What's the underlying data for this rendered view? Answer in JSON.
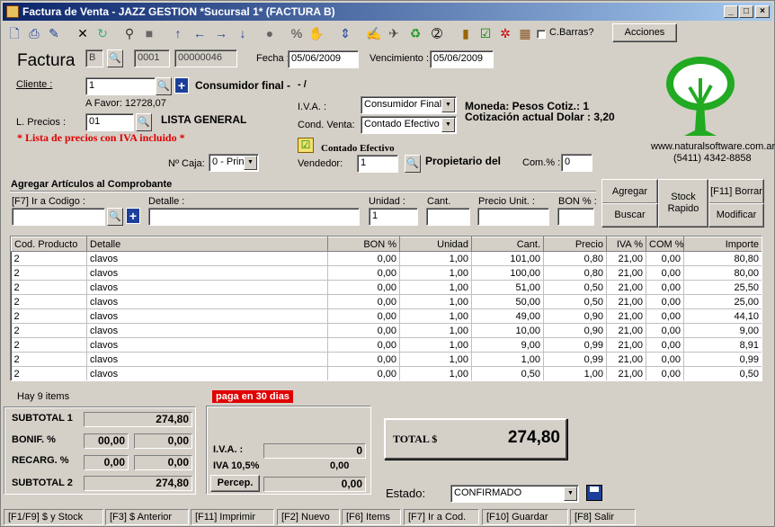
{
  "window": {
    "title": "Factura de Venta - JAZZ GESTION *Sucursal 1* (FACTURA B)"
  },
  "toolbar": {
    "barcode_label": "C.Barras?",
    "actions_label": "Acciones"
  },
  "header": {
    "factura_label": "Factura",
    "letter": "B",
    "punto_venta": "0001",
    "numero": "00000046",
    "fecha_label": "Fecha :",
    "fecha": "05/06/2009",
    "vencimiento_label": "Vencimiento :",
    "vencimiento": "05/06/2009",
    "cliente_label": "Cliente :",
    "cliente_code": "1",
    "cliente_name": "Consumidor final -",
    "cliente_extra": "- /",
    "a_favor": "A Favor: 12728,07",
    "lprecios_label": "L. Precios :",
    "lprecios_code": "01",
    "lprecios_name": "LISTA GENERAL",
    "iva_note": "* Lista de precios con IVA incluido *",
    "iva_label": "I.V.A. :",
    "iva_value": "Consumidor Final",
    "condventa_label": "Cond. Venta:",
    "condventa_value": "Contado Efectivo",
    "moneda": "Moneda: Pesos Cotiz.: 1",
    "cotizacion": "Cotización actual Dolar : 3,20",
    "contado_label": "Contado Efectivo",
    "caja_label": "Nº Caja:",
    "caja_value": "0 - Prin",
    "vendedor_label": "Vendedor:",
    "vendedor_code": "1",
    "vendedor_name": "Propietario del",
    "com_label": "Com.% :",
    "com_value": "0"
  },
  "company": {
    "web": "www.naturalsoftware.com.ar",
    "phone": "(5411) 4342-8858"
  },
  "add_items": {
    "section_title": "Agregar Artículos al Comprobante",
    "code_label": "[F7] Ir a Codigo :",
    "detail_label": "Detalle :",
    "unit_label": "Unidad :",
    "unit_value": "1",
    "qty_label": "Cant.",
    "price_label": "Precio Unit. :",
    "bon_label": "BON % :",
    "agregar": "Agregar",
    "buscar": "Buscar",
    "stock": "Stock Rapido",
    "borrar": "[F11] Borrar",
    "modificar": "Modificar"
  },
  "grid": {
    "columns": [
      "Cod. Producto",
      "Detalle",
      "BON %",
      "Unidad",
      "Cant.",
      "Precio",
      "IVA %",
      "COM %",
      "Importe"
    ],
    "rows": [
      [
        "2",
        "clavos",
        "0,00",
        "1,00",
        "101,00",
        "0,80",
        "21,00",
        "0,00",
        "80,80"
      ],
      [
        "2",
        "clavos",
        "0,00",
        "1,00",
        "100,00",
        "0,80",
        "21,00",
        "0,00",
        "80,00"
      ],
      [
        "2",
        "clavos",
        "0,00",
        "1,00",
        "51,00",
        "0,50",
        "21,00",
        "0,00",
        "25,50"
      ],
      [
        "2",
        "clavos",
        "0,00",
        "1,00",
        "50,00",
        "0,50",
        "21,00",
        "0,00",
        "25,00"
      ],
      [
        "2",
        "clavos",
        "0,00",
        "1,00",
        "49,00",
        "0,90",
        "21,00",
        "0,00",
        "44,10"
      ],
      [
        "2",
        "clavos",
        "0,00",
        "1,00",
        "10,00",
        "0,90",
        "21,00",
        "0,00",
        "9,00"
      ],
      [
        "2",
        "clavos",
        "0,00",
        "1,00",
        "9,00",
        "0,99",
        "21,00",
        "0,00",
        "8,91"
      ],
      [
        "2",
        "clavos",
        "0,00",
        "1,00",
        "1,00",
        "0,99",
        "21,00",
        "0,00",
        "0,99"
      ],
      [
        "2",
        "clavos",
        "0,00",
        "1,00",
        "0,50",
        "1,00",
        "21,00",
        "0,00",
        "0,50"
      ]
    ]
  },
  "footer": {
    "items_count": "Hay 9 items",
    "payment_note": "paga en  30 dias",
    "subtotal1_label": "SUBTOTAL 1",
    "subtotal1": "274,80",
    "bonif_label": "BONIF. %",
    "bonif_pct": "00,00",
    "bonif_amt": "0,00",
    "recarg_label": "RECARG. %",
    "recarg_pct": "0,00",
    "recarg_amt": "0,00",
    "subtotal2_label": "SUBTOTAL 2",
    "subtotal2": "274,80",
    "iva_label": "I.V.A. :",
    "iva_value": "0",
    "iva105_label": "IVA 10,5%",
    "iva105_value": "0,00",
    "percep_label": "Percep.",
    "percep_value": "0,00",
    "total_label": "TOTAL $",
    "total_value": "274,80",
    "estado_label": "Estado:",
    "estado_value": "CONFIRMADO"
  },
  "statusbar": [
    "[F1/F9] $ y Stock",
    "[F3] $ Anterior",
    "[F11] Imprimir",
    "[F2] Nuevo",
    "[F6] Items",
    "[F7] Ir a Cod.",
    "[F10] Guardar",
    "[F8] Salir"
  ],
  "colors": {
    "title_start": "#0a246a",
    "title_end": "#a6caf0",
    "accent_red": "#e00000",
    "tree_green": "#22aa22",
    "panel": "#d4d0c8"
  }
}
